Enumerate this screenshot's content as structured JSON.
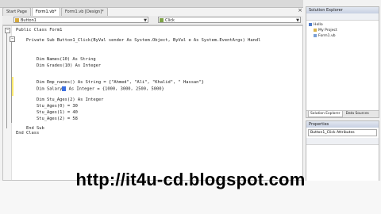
{
  "tabs": [
    {
      "label": "Start Page",
      "active": false
    },
    {
      "label": "Form1.vb*",
      "active": true
    },
    {
      "label": "Form1.vb [Design]*",
      "active": false
    }
  ],
  "selectors": {
    "object": "Button1",
    "event": "Click"
  },
  "code_lines": [
    "Public Class Form1",
    "",
    "    Private Sub Button1_Click(ByVal sender As System.Object, ByVal e As System.EventArgs) Handl",
    "",
    "",
    "        Dim Names(10) As String",
    "        Dim Grades(10) As Integer",
    "",
    "",
    "        Dim Emp_names() As String = {\"Ahmed\", \"Ali\", \"Khalid\", \" Hassan\"}",
    "        Dim Salary",
    "",
    "        Dim Stu_Ages(2) As Integer",
    "        Stu_Ages(0) = 30",
    "        Stu_Ages(1) = 40",
    "        Stu_Ages(2) = 58",
    "",
    "    End Sub",
    "End Class"
  ],
  "salary_rest": " As Integer = {1000, 3000, 2500, 5000}",
  "solution_explorer": {
    "title": "Solution Explorer",
    "items": [
      "Hello",
      "My Project",
      "Form1.vb"
    ],
    "tabs": [
      "Solution Explorer",
      "Data Sources"
    ]
  },
  "properties": {
    "title": "Properties",
    "selected": "Button1_Click Attributes"
  },
  "watermark": "http://it4u-cd.blogspot.com",
  "colors": {
    "accent": "#3b6fe0",
    "change_bar": "#ffe96a"
  }
}
